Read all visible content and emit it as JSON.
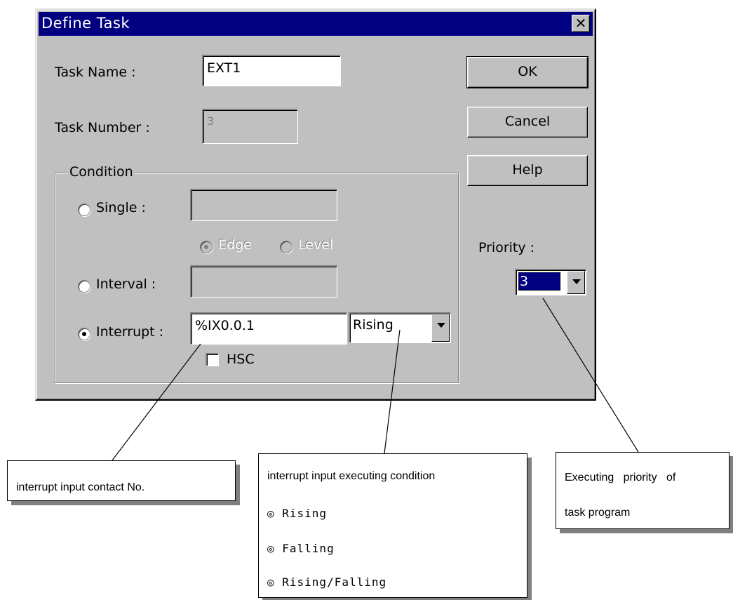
{
  "dialog": {
    "title": "Define Task",
    "close_glyph": "✕",
    "task_name_label": "Task Name :",
    "task_name_value": "EXT1",
    "task_number_label": "Task Number :",
    "task_number_value": "3",
    "ok_label": "OK",
    "cancel_label": "Cancel",
    "help_label": "Help",
    "condition": {
      "legend": "Condition",
      "single_label": "Single :",
      "single_value": "",
      "edge_label": "Edge",
      "level_label": "Level",
      "interval_label": "Interval :",
      "interval_value": "",
      "interrupt_label": "Interrupt :",
      "interrupt_value": "%IX0.0.1",
      "interrupt_condition": "Rising",
      "hsc_label": "HSC",
      "selected": "interrupt",
      "edge_selected": true,
      "hsc_checked": false
    },
    "priority_label": "Priority :",
    "priority_value": "3"
  },
  "callouts": {
    "contact": "interrupt input contact No.",
    "executing_title": "interrupt input executing condition",
    "options": [
      "◎ Rising",
      "◎ Falling",
      "◎ Rising/Falling"
    ],
    "priority_line1": "Executing   priority   of",
    "priority_line2": "task program"
  }
}
